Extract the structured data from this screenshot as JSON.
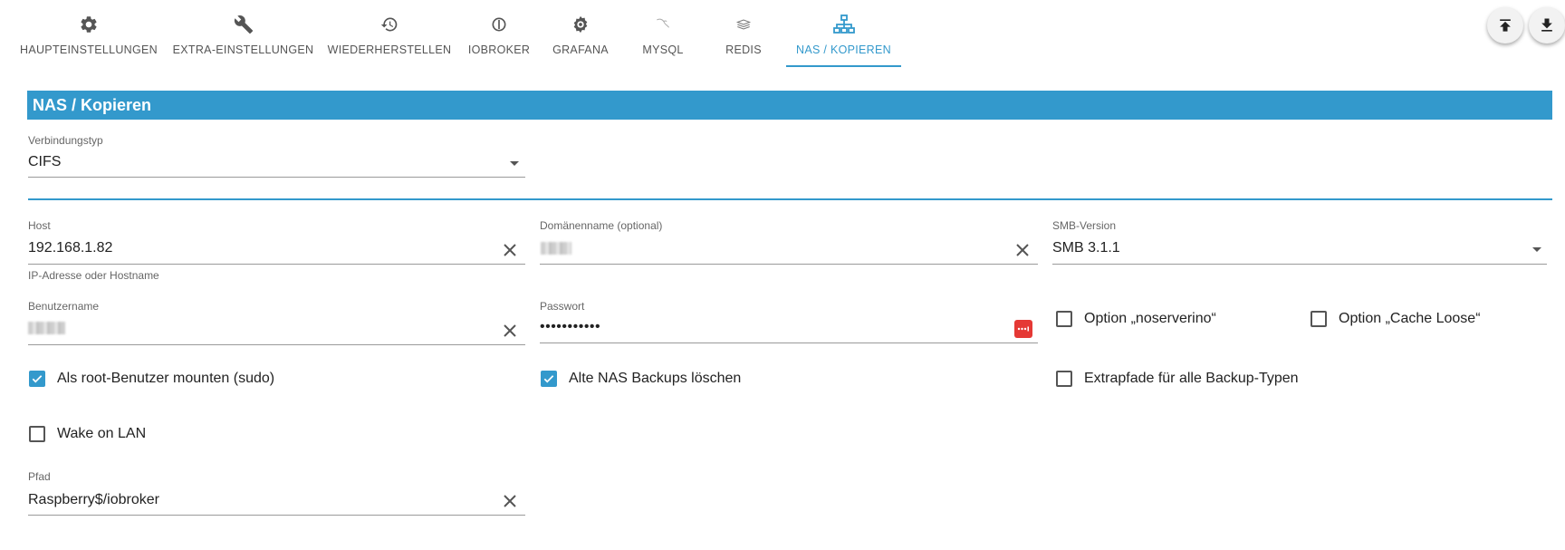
{
  "tabs": [
    {
      "label": "HAUPTEINSTELLUNGEN",
      "icon": "gear-icon"
    },
    {
      "label": "EXTRA-EINSTELLUNGEN",
      "icon": "wrench-icon"
    },
    {
      "label": "WIEDERHERSTELLEN",
      "icon": "restore-icon"
    },
    {
      "label": "IOBROKER",
      "icon": "iobroker-icon"
    },
    {
      "label": "GRAFANA",
      "icon": "grafana-icon"
    },
    {
      "label": "MYSQL",
      "icon": "mysql-icon"
    },
    {
      "label": "REDIS",
      "icon": "redis-icon"
    },
    {
      "label": "NAS / KOPIEREN",
      "icon": "network-icon",
      "active": true
    }
  ],
  "colors": {
    "accent": "#3399cc",
    "danger": "#e53935",
    "text": "#222222",
    "muted": "#666666"
  },
  "section": {
    "title": "NAS / Kopieren"
  },
  "fields": {
    "connection_type": {
      "label": "Verbindungstyp",
      "value": "CIFS"
    },
    "host": {
      "label": "Host",
      "value": "192.168.1.82",
      "helper": "IP-Adresse oder Hostname"
    },
    "domain": {
      "label": "Domänenname (optional)",
      "value": ""
    },
    "smb_version": {
      "label": "SMB-Version",
      "value": "SMB 3.1.1"
    },
    "username": {
      "label": "Benutzername",
      "value": ""
    },
    "password": {
      "label": "Passwort",
      "value": "•••••••••••"
    },
    "path": {
      "label": "Pfad",
      "value": "Raspberry$/iobroker"
    }
  },
  "checkboxes": {
    "noserverino": {
      "label": "Option „noserverino“",
      "checked": false
    },
    "cache_loose": {
      "label": "Option „Cache Loose“",
      "checked": false
    },
    "sudo_mount": {
      "label": "Als root-Benutzer mounten (sudo)",
      "checked": true
    },
    "delete_old": {
      "label": "Alte NAS Backups löschen",
      "checked": true
    },
    "extra_paths": {
      "label": "Extrapfade für alle Backup-Typen",
      "checked": false
    },
    "wake_on_lan": {
      "label": "Wake on LAN",
      "checked": false
    }
  },
  "actions": {
    "upload_icon": "upload-icon",
    "download_icon": "download-icon"
  }
}
